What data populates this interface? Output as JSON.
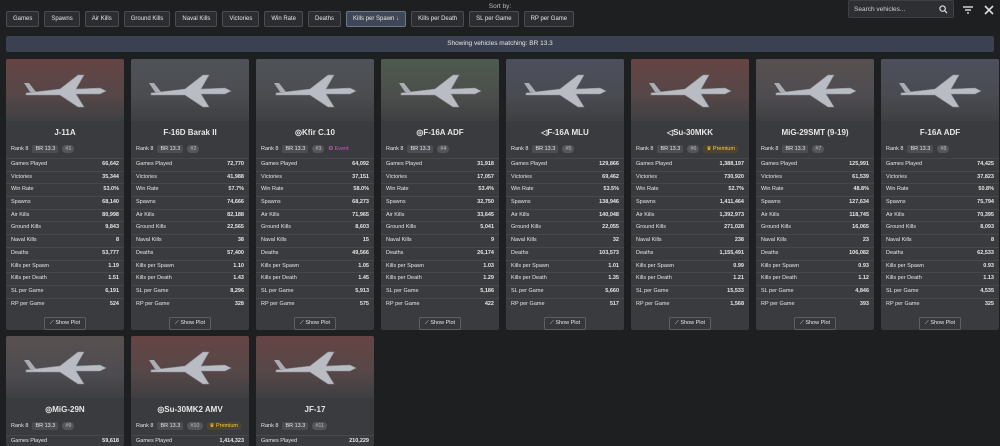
{
  "sort": {
    "label": "Sort by:",
    "buttons": [
      "Games",
      "Spawns",
      "Air Kills",
      "Ground Kills",
      "Naval Kills",
      "Victories",
      "Win Rate",
      "Deaths",
      "Kills per Spawn",
      "Kills per Death",
      "SL per Game",
      "RP per Game"
    ],
    "active_index": 8,
    "active_suffix": "↓"
  },
  "search": {
    "placeholder": "Search vehicles..."
  },
  "status": {
    "text": "Showing vehicles matching: BR 13.3"
  },
  "stat_labels": [
    "Games Played",
    "Victories",
    "Win Rate",
    "Spawns",
    "Air Kills",
    "Ground Kills",
    "Naval Kills",
    "Deaths",
    "Kills per Spawn",
    "Kills per Death",
    "SL per Game",
    "RP per Game"
  ],
  "show_plot_label": "Show Plot",
  "vehicles": [
    {
      "name": "J-11A",
      "nation": "cn",
      "rank": "Rank 8",
      "br": "BR 13.3",
      "num": "#1",
      "tag": "",
      "stats": [
        "66,642",
        "35,344",
        "53.0%",
        "68,140",
        "80,998",
        "9,843",
        "8",
        "53,777",
        "1.19",
        "1.51",
        "6,191",
        "524"
      ]
    },
    {
      "name": "F-16D Barak II",
      "nation": "il",
      "rank": "Rank 8",
      "br": "BR 13.3",
      "num": "#2",
      "tag": "",
      "stats": [
        "72,770",
        "41,988",
        "57.7%",
        "74,666",
        "82,188",
        "22,565",
        "38",
        "57,400",
        "1.10",
        "1.43",
        "8,296",
        "328"
      ]
    },
    {
      "name": "◎Kfir C.10",
      "nation": "il",
      "rank": "Rank 8",
      "br": "BR 13.3",
      "num": "#3",
      "tag": "Event",
      "stats": [
        "64,092",
        "37,151",
        "58.0%",
        "68,273",
        "71,965",
        "8,603",
        "15",
        "49,566",
        "1.05",
        "1.45",
        "5,913",
        "575"
      ]
    },
    {
      "name": "◎F-16A ADF",
      "nation": "fr",
      "rank": "Rank 8",
      "br": "BR 13.3",
      "num": "#4",
      "tag": "",
      "stats": [
        "31,918",
        "17,057",
        "53.4%",
        "32,750",
        "33,645",
        "5,041",
        "9",
        "26,174",
        "1.03",
        "1.29",
        "5,186",
        "422"
      ]
    },
    {
      "name": "◁F-16A MLU",
      "nation": "us",
      "rank": "Rank 8",
      "br": "BR 13.3",
      "num": "#5",
      "tag": "",
      "stats": [
        "129,866",
        "69,462",
        "53.5%",
        "138,946",
        "140,048",
        "22,055",
        "32",
        "103,573",
        "1.01",
        "1.35",
        "5,660",
        "517"
      ]
    },
    {
      "name": "◁Su-30MKK",
      "nation": "cn",
      "rank": "Rank 8",
      "br": "BR 13.3",
      "num": "#6",
      "tag": "Premium",
      "stats": [
        "1,388,197",
        "730,920",
        "52.7%",
        "1,411,464",
        "1,392,973",
        "271,028",
        "238",
        "1,155,491",
        "0.99",
        "1.21",
        "15,533",
        "1,568"
      ]
    },
    {
      "name": "MiG-29SMT (9-19)",
      "nation": "ru",
      "rank": "Rank 8",
      "br": "BR 13.3",
      "num": "#7",
      "tag": "",
      "stats": [
        "125,991",
        "61,539",
        "48.8%",
        "127,634",
        "118,745",
        "16,065",
        "23",
        "106,082",
        "0.93",
        "1.12",
        "4,846",
        "393"
      ]
    },
    {
      "name": "F-16A ADF",
      "nation": "us",
      "rank": "Rank 8",
      "br": "BR 13.3",
      "num": "#8",
      "tag": "",
      "stats": [
        "74,425",
        "37,823",
        "50.8%",
        "75,794",
        "70,395",
        "8,093",
        "8",
        "62,533",
        "0.93",
        "1.13",
        "4,535",
        "325"
      ]
    },
    {
      "name": "◎MiG-29N",
      "nation": "ru",
      "rank": "Rank 8",
      "br": "BR 13.3",
      "num": "#9",
      "tag": "",
      "stats": [
        "59,618",
        "",
        "",
        "",
        "",
        "",
        "",
        "",
        "",
        "",
        "",
        ""
      ]
    },
    {
      "name": "◎Su-30MK2 AMV",
      "nation": "cn",
      "rank": "Rank 8",
      "br": "BR 13.3",
      "num": "#10",
      "tag": "Premium",
      "stats": [
        "1,414,323",
        "",
        "",
        "",
        "",
        "",
        "",
        "",
        "",
        "",
        "",
        ""
      ]
    },
    {
      "name": "JF-17",
      "nation": "cn",
      "rank": "Rank 8",
      "br": "BR 13.3",
      "num": "#11",
      "tag": "",
      "stats": [
        "210,229",
        "",
        "",
        "",
        "",
        "",
        "",
        "",
        "",
        "",
        "",
        ""
      ]
    }
  ],
  "colors": {
    "background": "#1e1f21",
    "card": "#3a3b3e",
    "status_bar": "#3b4150",
    "premium": "#ffcc33",
    "event": "#cc55cc"
  },
  "icons": {
    "search": "search-icon",
    "filter": "filter-icon",
    "close": "close-icon",
    "sort": "sort-desc-icon",
    "plot": "chart-icon",
    "premium": "premium-icon",
    "event": "event-icon"
  }
}
